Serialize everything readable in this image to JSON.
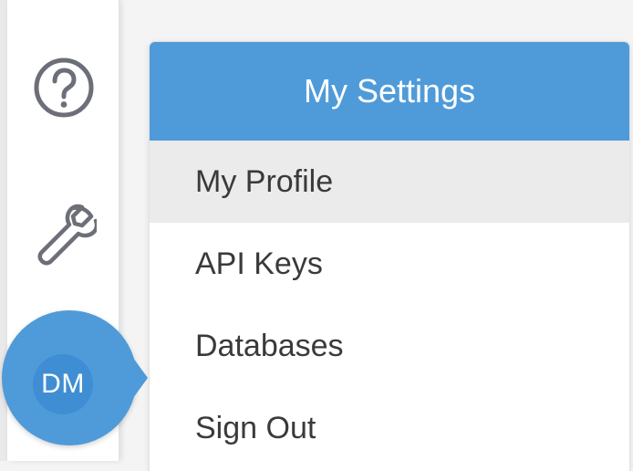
{
  "sidebar": {
    "help_icon": "question-circle-icon",
    "settings_icon": "wrench-icon",
    "avatar_initials": "DM"
  },
  "menu": {
    "title": "My Settings",
    "items": [
      {
        "label": "My Profile",
        "active": true
      },
      {
        "label": "API Keys",
        "active": false
      },
      {
        "label": "Databases",
        "active": false
      },
      {
        "label": "Sign Out",
        "active": false
      }
    ]
  },
  "colors": {
    "accent": "#4f9bd9",
    "avatar_inner": "#3f8ed3",
    "text": "#3a3a3a",
    "icon": "#6d6f78",
    "active_row": "#ebebeb"
  }
}
